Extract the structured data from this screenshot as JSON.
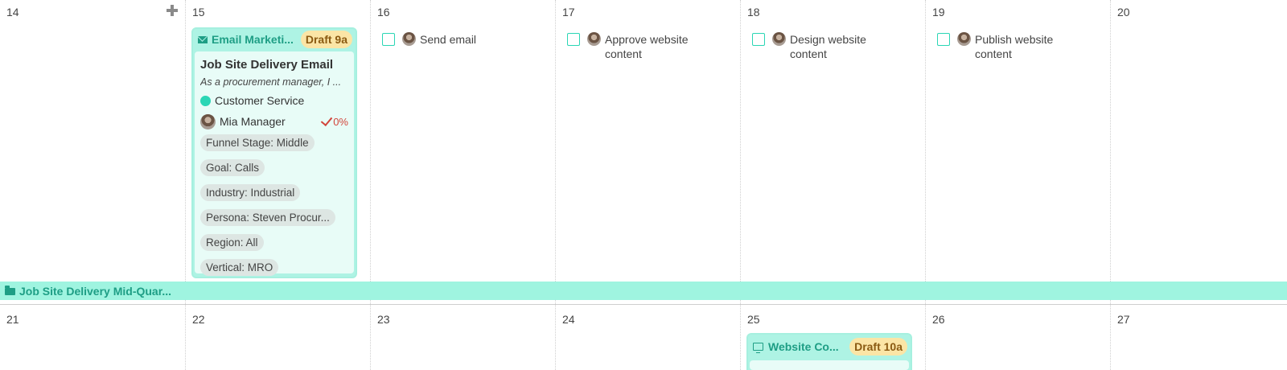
{
  "week1": {
    "days": [
      "14",
      "15",
      "16",
      "17",
      "18",
      "19",
      "20"
    ]
  },
  "card": {
    "type_label": "Email Marketi...",
    "badge": "Draft 9a",
    "title": "Job Site Delivery Email",
    "description": "As a procurement manager, I ...",
    "team": "Customer Service",
    "owner": "Mia Manager",
    "progress": "0%",
    "tags": [
      "Funnel Stage: Middle",
      "Goal: Calls",
      "Industry: Industrial",
      "Persona: Steven Procur...",
      "Region: All",
      "Vertical: MRO"
    ]
  },
  "tasks": [
    {
      "label": "Send email"
    },
    {
      "label": "Approve website content"
    },
    {
      "label": "Design website content"
    },
    {
      "label": "Publish website content"
    }
  ],
  "campaign_band": {
    "label": "Job Site Delivery Mid-Quar..."
  },
  "week2": {
    "days": [
      "21",
      "22",
      "23",
      "24",
      "25",
      "26",
      "27"
    ]
  },
  "card2": {
    "type_label": "Website Co...",
    "badge": "Draft 10a"
  },
  "colors": {
    "accent": "#2bd6b5",
    "card_bg": "#aef3e4",
    "card_body_bg": "#e8fcf7",
    "badge_bg": "#fbe5a6",
    "progress": "#d2453b"
  }
}
